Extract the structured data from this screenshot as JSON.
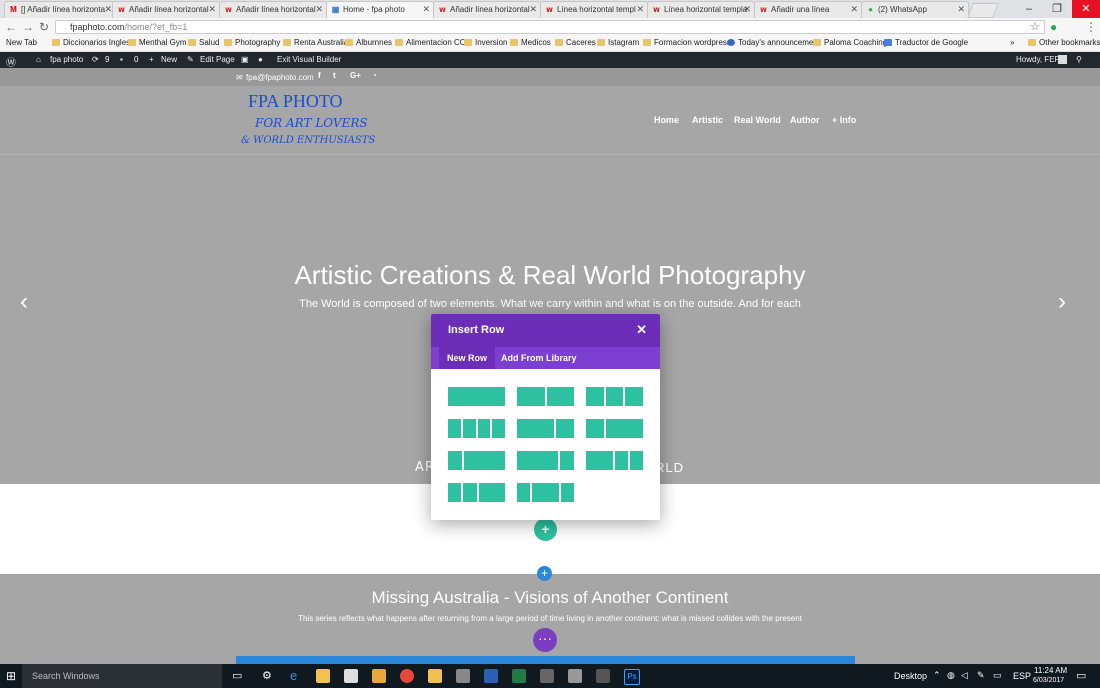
{
  "browser": {
    "tabs": [
      {
        "label": "[] Añadir línea horizonta",
        "favicon": "M"
      },
      {
        "label": "Añadir línea horizontal",
        "favicon": "w"
      },
      {
        "label": "Añadir línea horizontal",
        "favicon": "w"
      },
      {
        "label": "Home - fpa photo",
        "favicon": "▦",
        "active": true
      },
      {
        "label": "Añadir línea horizontal",
        "favicon": "w"
      },
      {
        "label": "Línea horizontal templ",
        "favicon": "w"
      },
      {
        "label": "Línea horizontal templa",
        "favicon": "w"
      },
      {
        "label": "Añadir una línea",
        "favicon": "w"
      },
      {
        "label": "(2) WhatsApp",
        "favicon": "●"
      }
    ],
    "url_host": "fpaphoto.com",
    "url_path": "/home/?et_fb=1",
    "bookmarks": [
      "New Tab",
      "Diccionarios Ingles",
      "Menthal Gym",
      "Salud",
      "Photography",
      "Renta Australia",
      "Alburnnes",
      "Alimentacion CC",
      "Inversion",
      "Medicos",
      "Caceres",
      "Istagram",
      "Formacion wordpress",
      "Today's announceme",
      "Paloma Coaching",
      "Traductor de Google"
    ],
    "bookmarks_overflow": "»",
    "other_bookmarks": "Other bookmarks"
  },
  "adminbar": {
    "site_name": "fpa photo",
    "updates": "9",
    "comments": "0",
    "new_label": "New",
    "edit_page": "Edit Page",
    "exit_builder": "Exit Visual Builder",
    "howdy": "Howdy, FER"
  },
  "site": {
    "email": "fpa@fpaphoto.com",
    "social": [
      "f",
      "t",
      "G+",
      "rss"
    ],
    "logo_title": "FPA PHOTO",
    "logo_line1": "FOR ART LOVERS",
    "logo_line2": "& WORLD ENTHUSIASTS",
    "nav": [
      "Home",
      "Artistic",
      "Real World",
      "Author",
      "+ Info"
    ]
  },
  "hero": {
    "title": "Artistic Creations & Real World Photography",
    "subtitle": "The World is composed of two elements. What we carry within and what is on the outside. And for each"
  },
  "section": {
    "heading_left": "ART",
    "heading_right": "RLD"
  },
  "missing": {
    "title": "Missing Australia - Visions of Another Continent",
    "subtitle": "This series reflects what happens after returning from a large period of time living in another continent: what is missed collides with the present"
  },
  "modal": {
    "title": "Insert Row",
    "tabs": [
      "New Row",
      "Add From Library"
    ],
    "active_tab": "New Row",
    "layouts": [
      [
        1
      ],
      [
        1,
        1
      ],
      [
        1,
        1,
        1
      ],
      [
        1,
        1,
        1,
        1
      ],
      [
        2,
        1
      ],
      [
        1,
        2
      ],
      [
        1,
        3
      ],
      [
        3,
        1
      ],
      [
        2,
        1,
        1
      ],
      [
        1,
        1,
        2
      ],
      [
        1,
        2,
        1
      ]
    ]
  },
  "taskbar": {
    "search_placeholder": "Search Windows",
    "desktop_label": "Desktop",
    "language": "ESP",
    "time": "11:24 AM",
    "date": "6/03/2017"
  },
  "colors": {
    "modal_header": "#6c2eb9",
    "modal_tabs": "#7d3fd1",
    "layout_block": "#2ec1a1",
    "logo_blue": "#1a4fd0",
    "adminbar": "#23282d"
  }
}
